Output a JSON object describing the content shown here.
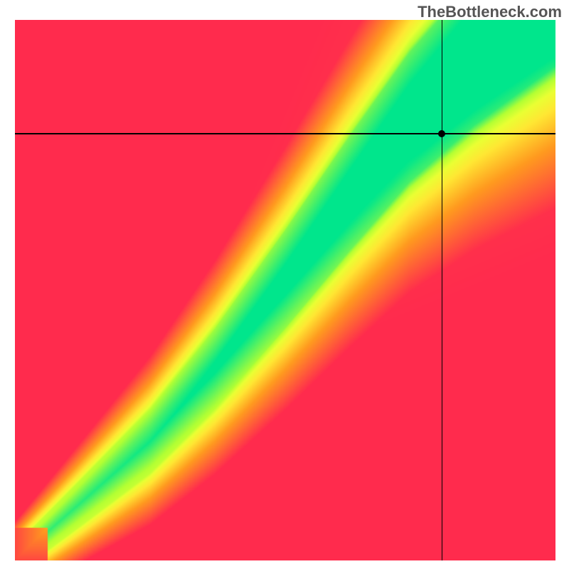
{
  "watermark": "TheBottleneck.com",
  "chart_data": {
    "type": "heatmap",
    "title": "",
    "xlabel": "",
    "ylabel": "",
    "xlim": [
      0,
      100
    ],
    "ylim": [
      0,
      100
    ],
    "crosshair": {
      "x": 79,
      "y": 79
    },
    "ridge": {
      "description": "optimal-match diagonal band (green) on red-yellow cost surface",
      "points_xy": [
        [
          0,
          0
        ],
        [
          12,
          10.5
        ],
        [
          25,
          22
        ],
        [
          37,
          35.5
        ],
        [
          50,
          52
        ],
        [
          62,
          68
        ],
        [
          73,
          82
        ],
        [
          85,
          94
        ],
        [
          92,
          100
        ]
      ],
      "band_width_pct": 9
    },
    "color_stops": [
      {
        "t": 0.0,
        "hex": "#ff2b4d"
      },
      {
        "t": 0.45,
        "hex": "#ff9a1f"
      },
      {
        "t": 0.7,
        "hex": "#ffe733"
      },
      {
        "t": 0.82,
        "hex": "#eaff33"
      },
      {
        "t": 0.9,
        "hex": "#b3ff33"
      },
      {
        "t": 1.0,
        "hex": "#00e68c"
      }
    ]
  }
}
